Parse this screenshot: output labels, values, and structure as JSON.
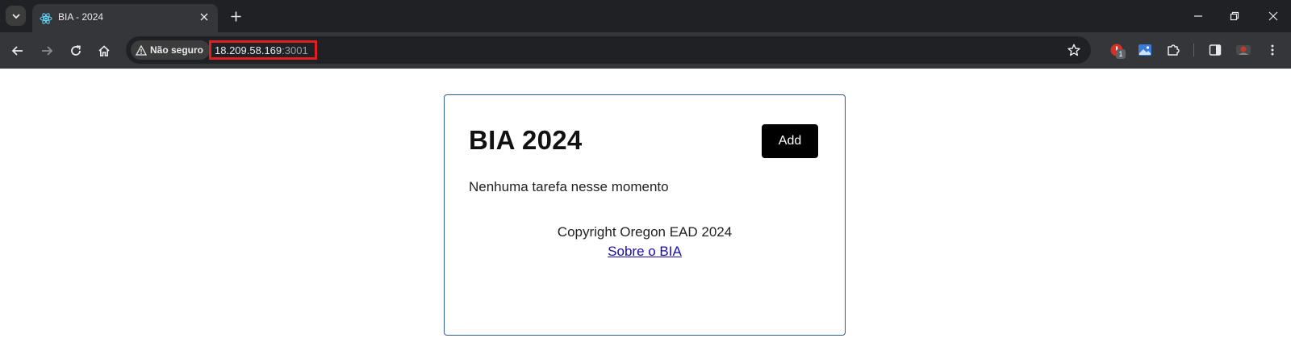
{
  "browser": {
    "tab": {
      "title": "BIA - 2024"
    },
    "security": {
      "label": "Não seguro"
    },
    "url": {
      "host": "18.209.58.169",
      "port": ":3001"
    },
    "extensions": [
      {
        "name": "extension-red-icon",
        "badge": "1"
      },
      {
        "name": "extension-image-icon"
      }
    ],
    "colors": {
      "tabbar": "#202124",
      "toolbar": "#35363a",
      "highlight": "#e02020"
    }
  },
  "page": {
    "title": "BIA 2024",
    "add_label": "Add",
    "empty_message": "Nenhuma tarefa nesse momento",
    "footer": {
      "copyright": "Copyright Oregon EAD 2024",
      "about_link": "Sobre o BIA"
    },
    "colors": {
      "card_border": "#2f5f8f",
      "button_bg": "#000000",
      "link": "#1a0dab"
    }
  }
}
